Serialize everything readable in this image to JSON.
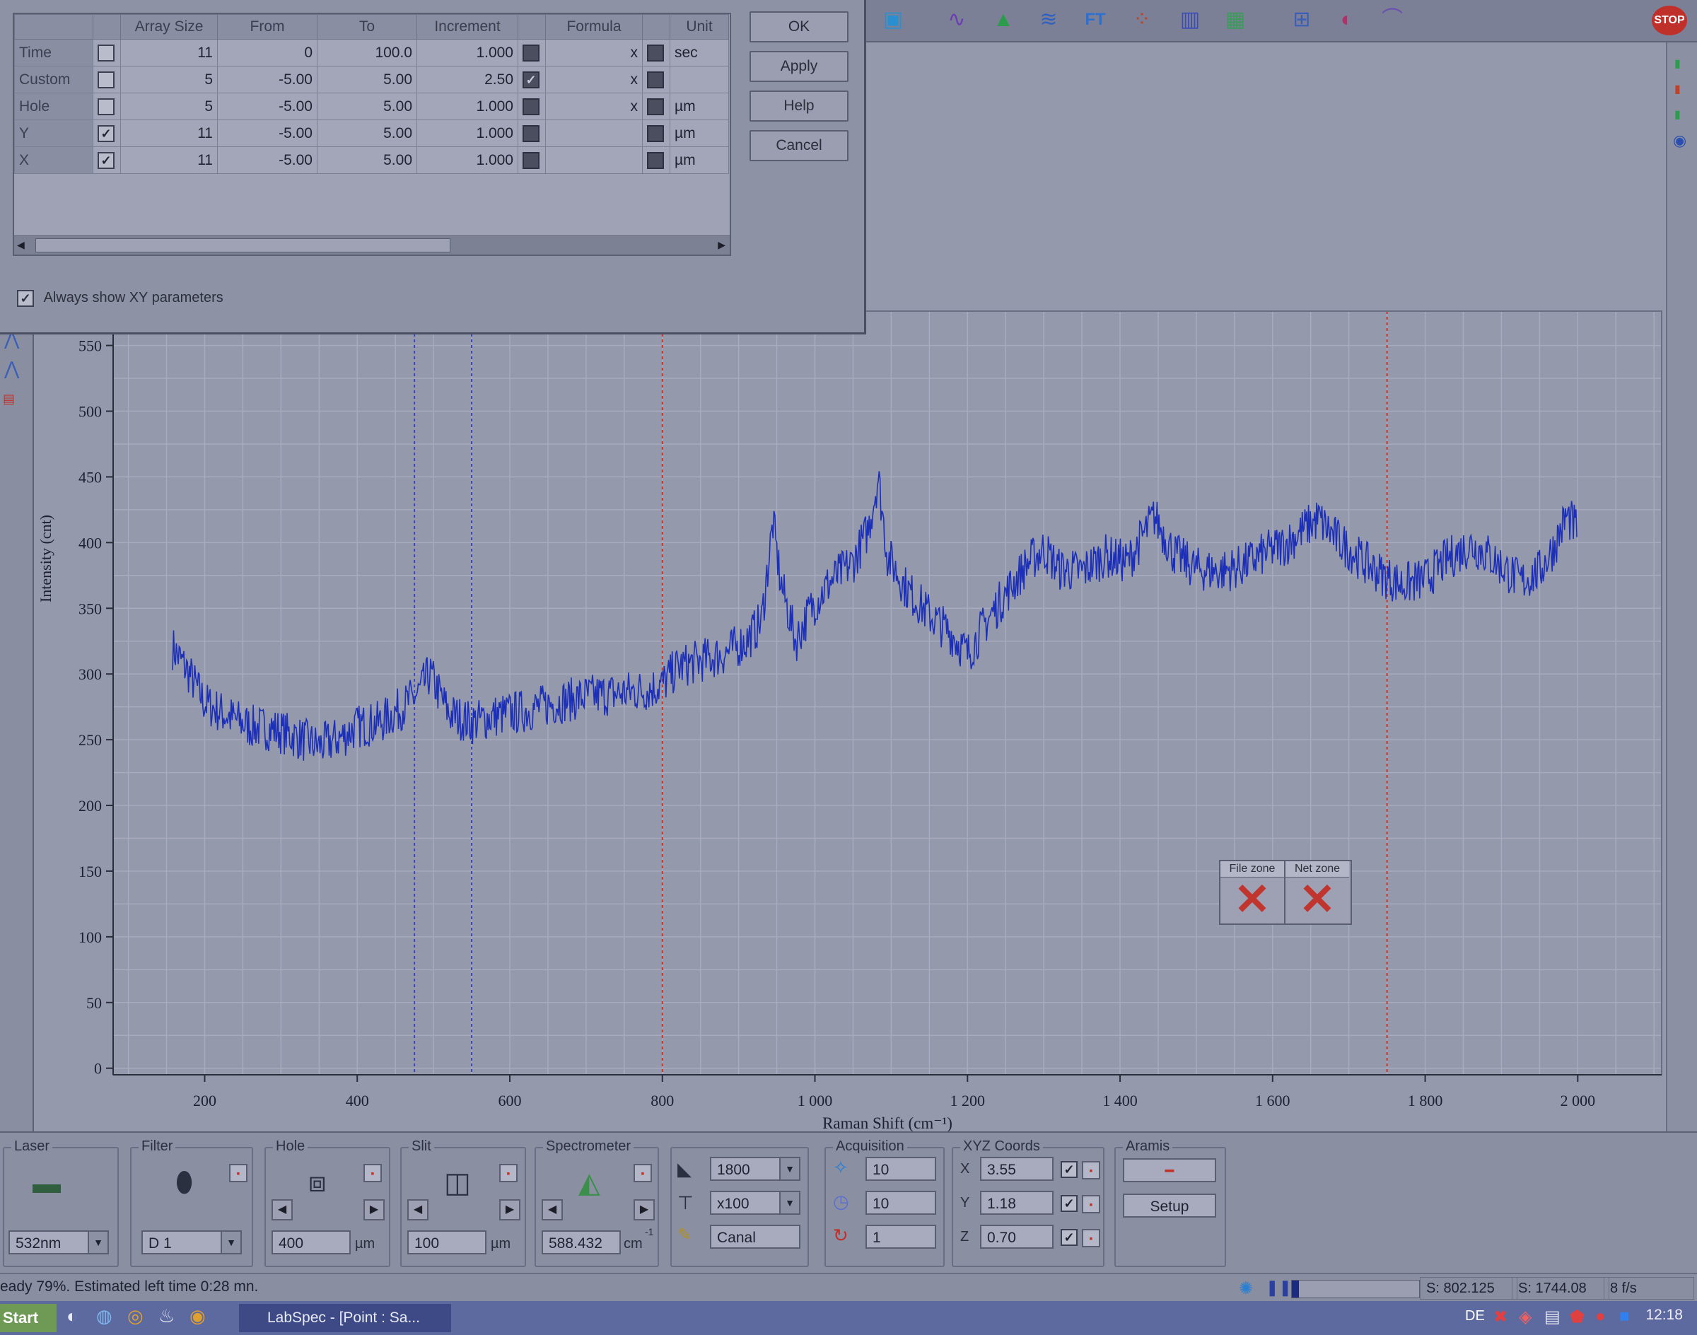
{
  "dialog": {
    "columns": [
      "",
      "",
      "Array Size",
      "From",
      "To",
      "Increment",
      "",
      "Formula",
      "",
      "Unit"
    ],
    "rows": [
      {
        "name": "Time",
        "check": false,
        "size": "11",
        "from": "0",
        "to": "100.0",
        "inc": "1.000",
        "inc_check": false,
        "formula": "x",
        "f_check": false,
        "unit": "sec"
      },
      {
        "name": "Custom",
        "check": false,
        "size": "5",
        "from": "-5.00",
        "to": "5.00",
        "inc": "2.50",
        "inc_check": true,
        "formula": "x",
        "f_check": false,
        "unit": ""
      },
      {
        "name": "Hole",
        "check": false,
        "size": "5",
        "from": "-5.00",
        "to": "5.00",
        "inc": "1.000",
        "inc_check": false,
        "formula": "x",
        "f_check": false,
        "unit": "µm"
      },
      {
        "name": "Y",
        "check": true,
        "size": "11",
        "from": "-5.00",
        "to": "5.00",
        "inc": "1.000",
        "inc_check": false,
        "formula": "",
        "f_check": false,
        "unit": "µm"
      },
      {
        "name": "X",
        "check": true,
        "size": "11",
        "from": "-5.00",
        "to": "5.00",
        "inc": "1.000",
        "inc_check": false,
        "formula": "",
        "f_check": false,
        "unit": "µm"
      }
    ],
    "buttons": {
      "ok": "OK",
      "apply": "Apply",
      "help": "Help",
      "cancel": "Cancel"
    },
    "always_show_label": "Always show XY parameters",
    "always_show_checked": true
  },
  "chart_data": {
    "type": "line",
    "title": "",
    "xlabel": "Raman Shift (cm⁻¹)",
    "ylabel": "Intensity (cnt)",
    "xlim": [
      80,
      2110
    ],
    "ylim": [
      -5,
      560
    ],
    "xticks": [
      200,
      400,
      600,
      800,
      1000,
      1200,
      1400,
      1600,
      1800,
      2000
    ],
    "xtick_labels": [
      "200",
      "400",
      "600",
      "800",
      "1 000",
      "1 200",
      "1 400",
      "1 600",
      "1 800",
      "2 000"
    ],
    "yticks": [
      0,
      50,
      100,
      150,
      200,
      250,
      300,
      350,
      400,
      450,
      500,
      550
    ],
    "ytick_labels": [
      "0",
      "50",
      "100",
      "150",
      "200",
      "250",
      "300",
      "350",
      "400",
      "450",
      "500",
      "550"
    ],
    "grid": true,
    "vlines_blue": [
      475,
      550
    ],
    "vlines_red": [
      800,
      1750
    ],
    "series": [
      {
        "name": "",
        "color": "#1c2fb8",
        "x": [
          158,
          180,
          200,
          230,
          260,
          290,
          320,
          350,
          380,
          400,
          430,
          460,
          480,
          495,
          520,
          550,
          580,
          620,
          660,
          700,
          740,
          780,
          800,
          820,
          850,
          880,
          910,
          930,
          945,
          955,
          975,
          995,
          1020,
          1050,
          1070,
          1083,
          1095,
          1120,
          1150,
          1180,
          1200,
          1225,
          1255,
          1280,
          1300,
          1320,
          1350,
          1380,
          1410,
          1445,
          1470,
          1500,
          1530,
          1560,
          1590,
          1620,
          1640,
          1660,
          1680,
          1700,
          1720,
          1745,
          1770,
          1800,
          1830,
          1860,
          1880,
          1900,
          1925,
          1950,
          1970,
          1985,
          2000
        ],
        "y": [
          320,
          300,
          278,
          268,
          260,
          258,
          252,
          245,
          252,
          260,
          263,
          275,
          285,
          300,
          270,
          263,
          268,
          272,
          278,
          283,
          285,
          288,
          292,
          305,
          310,
          315,
          325,
          340,
          415,
          370,
          325,
          350,
          370,
          385,
          410,
          450,
          390,
          365,
          345,
          330,
          315,
          340,
          365,
          385,
          395,
          380,
          378,
          390,
          385,
          420,
          392,
          380,
          378,
          382,
          392,
          400,
          410,
          418,
          405,
          395,
          385,
          375,
          368,
          372,
          388,
          398,
          392,
          382,
          370,
          378,
          398,
          420,
          410
        ]
      }
    ]
  },
  "status_zones": {
    "file_zone": "File zone",
    "net_zone": "Net zone"
  },
  "bottom": {
    "laser": {
      "title": "Laser",
      "value": "532nm"
    },
    "filter": {
      "title": "Filter",
      "value": "D 1"
    },
    "hole": {
      "title": "Hole",
      "value": "400",
      "unit": "µm"
    },
    "slit": {
      "title": "Slit",
      "value": "100",
      "unit": "µm"
    },
    "spectrometer": {
      "title": "Spectrometer",
      "value": "588.432",
      "unit": "cm",
      "unit_sup": "-1"
    },
    "grating": {
      "grating": "1800",
      "objective": "x100",
      "channel": "Canal"
    },
    "acquisition": {
      "title": "Acquisition",
      "time": "10",
      "accum": "10",
      "repeat": "1"
    },
    "xyz": {
      "title": "XYZ Coords",
      "x_label": "X",
      "x": "3.55",
      "y_label": "Y",
      "y": "1.18",
      "z_label": "Z",
      "z": "0.70"
    },
    "aramis": {
      "title": "Aramis",
      "setup": "Setup"
    }
  },
  "status_bar": {
    "text": "eady 79%. Estimated left time 0:28 mn.",
    "s1": "S: 802.125",
    "s2": "S: 1744.08",
    "rate": "8 f/s"
  },
  "taskbar": {
    "start": "Start",
    "app": "LabSpec - [Point : Sa...",
    "clock": "12:18",
    "lang": "DE"
  },
  "toolbar": {
    "stop": "STOP"
  },
  "colors": {
    "spectrum": "#1c2fb8",
    "red_line": "#c0392b",
    "blue_line": "#3a45c8",
    "background": "#8f93a6"
  }
}
